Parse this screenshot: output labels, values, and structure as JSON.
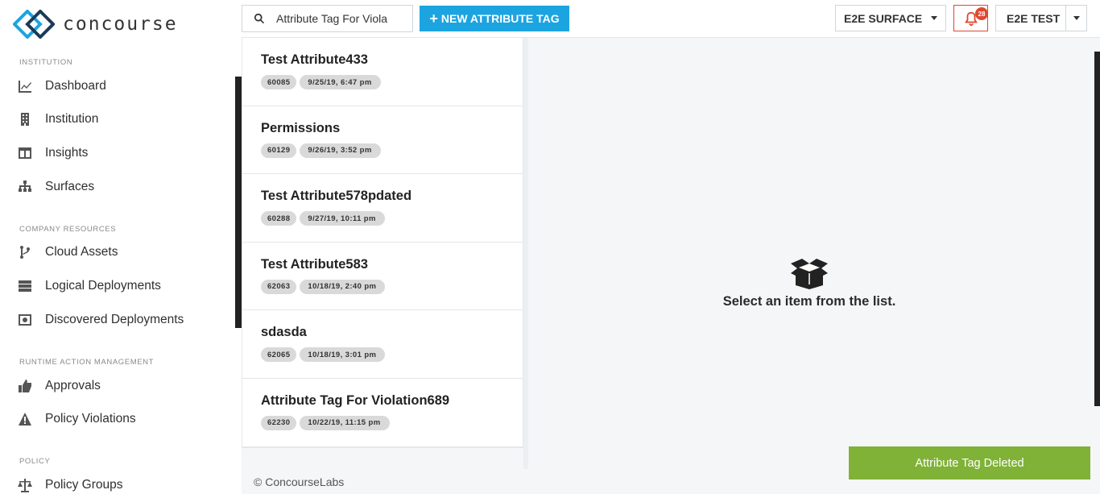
{
  "brand": {
    "name": "concourse"
  },
  "search": {
    "value": "Attribute Tag For Viola"
  },
  "toolbar": {
    "new_label": "NEW ATTRIBUTE TAG"
  },
  "surface_selector": {
    "selected": "E2E SURFACE"
  },
  "notifications": {
    "count": "28"
  },
  "user_selector": {
    "selected": "E2E TEST"
  },
  "sidebar": {
    "sections": [
      {
        "title": "INSTITUTION",
        "items": [
          {
            "label": "Dashboard",
            "icon": "chart-icon"
          },
          {
            "label": "Institution",
            "icon": "building-icon"
          },
          {
            "label": "Insights",
            "icon": "columns-icon"
          },
          {
            "label": "Surfaces",
            "icon": "sitemap-icon"
          }
        ]
      },
      {
        "title": "COMPANY RESOURCES",
        "items": [
          {
            "label": "Cloud Assets",
            "icon": "branch-icon"
          },
          {
            "label": "Logical Deployments",
            "icon": "server-icon"
          },
          {
            "label": "Discovered Deployments",
            "icon": "discovered-icon"
          }
        ]
      },
      {
        "title": "RUNTIME ACTION MANAGEMENT",
        "items": [
          {
            "label": "Approvals",
            "icon": "thumbs-up-icon"
          },
          {
            "label": "Policy Violations",
            "icon": "warning-icon"
          }
        ]
      },
      {
        "title": "POLICY",
        "items": [
          {
            "label": "Policy Groups",
            "icon": "balance-icon"
          }
        ]
      }
    ]
  },
  "list": {
    "items": [
      {
        "title": "Test Attribute433",
        "id": "60085",
        "date": "9/25/19, 6:47 pm"
      },
      {
        "title": "Permissions",
        "id": "60129",
        "date": "9/26/19, 3:52 pm"
      },
      {
        "title": "Test Attribute578pdated",
        "id": "60288",
        "date": "9/27/19, 10:11 pm"
      },
      {
        "title": "Test Attribute583",
        "id": "62063",
        "date": "10/18/19, 2:40 pm"
      },
      {
        "title": "sdasda",
        "id": "62065",
        "date": "10/18/19, 3:01 pm"
      },
      {
        "title": "Attribute Tag For Violation689",
        "id": "62230",
        "date": "10/22/19, 11:15 pm"
      }
    ]
  },
  "empty_state": {
    "message": "Select an item from the list.",
    "icon": "open-box-icon"
  },
  "footer": {
    "copyright": "© ConcourseLabs"
  },
  "toast": {
    "message": "Attribute Tag Deleted"
  },
  "colors": {
    "accent": "#1ca4e0",
    "toast": "#7fb236",
    "alert": "#e0472f",
    "badge": "#d9d9d9"
  }
}
